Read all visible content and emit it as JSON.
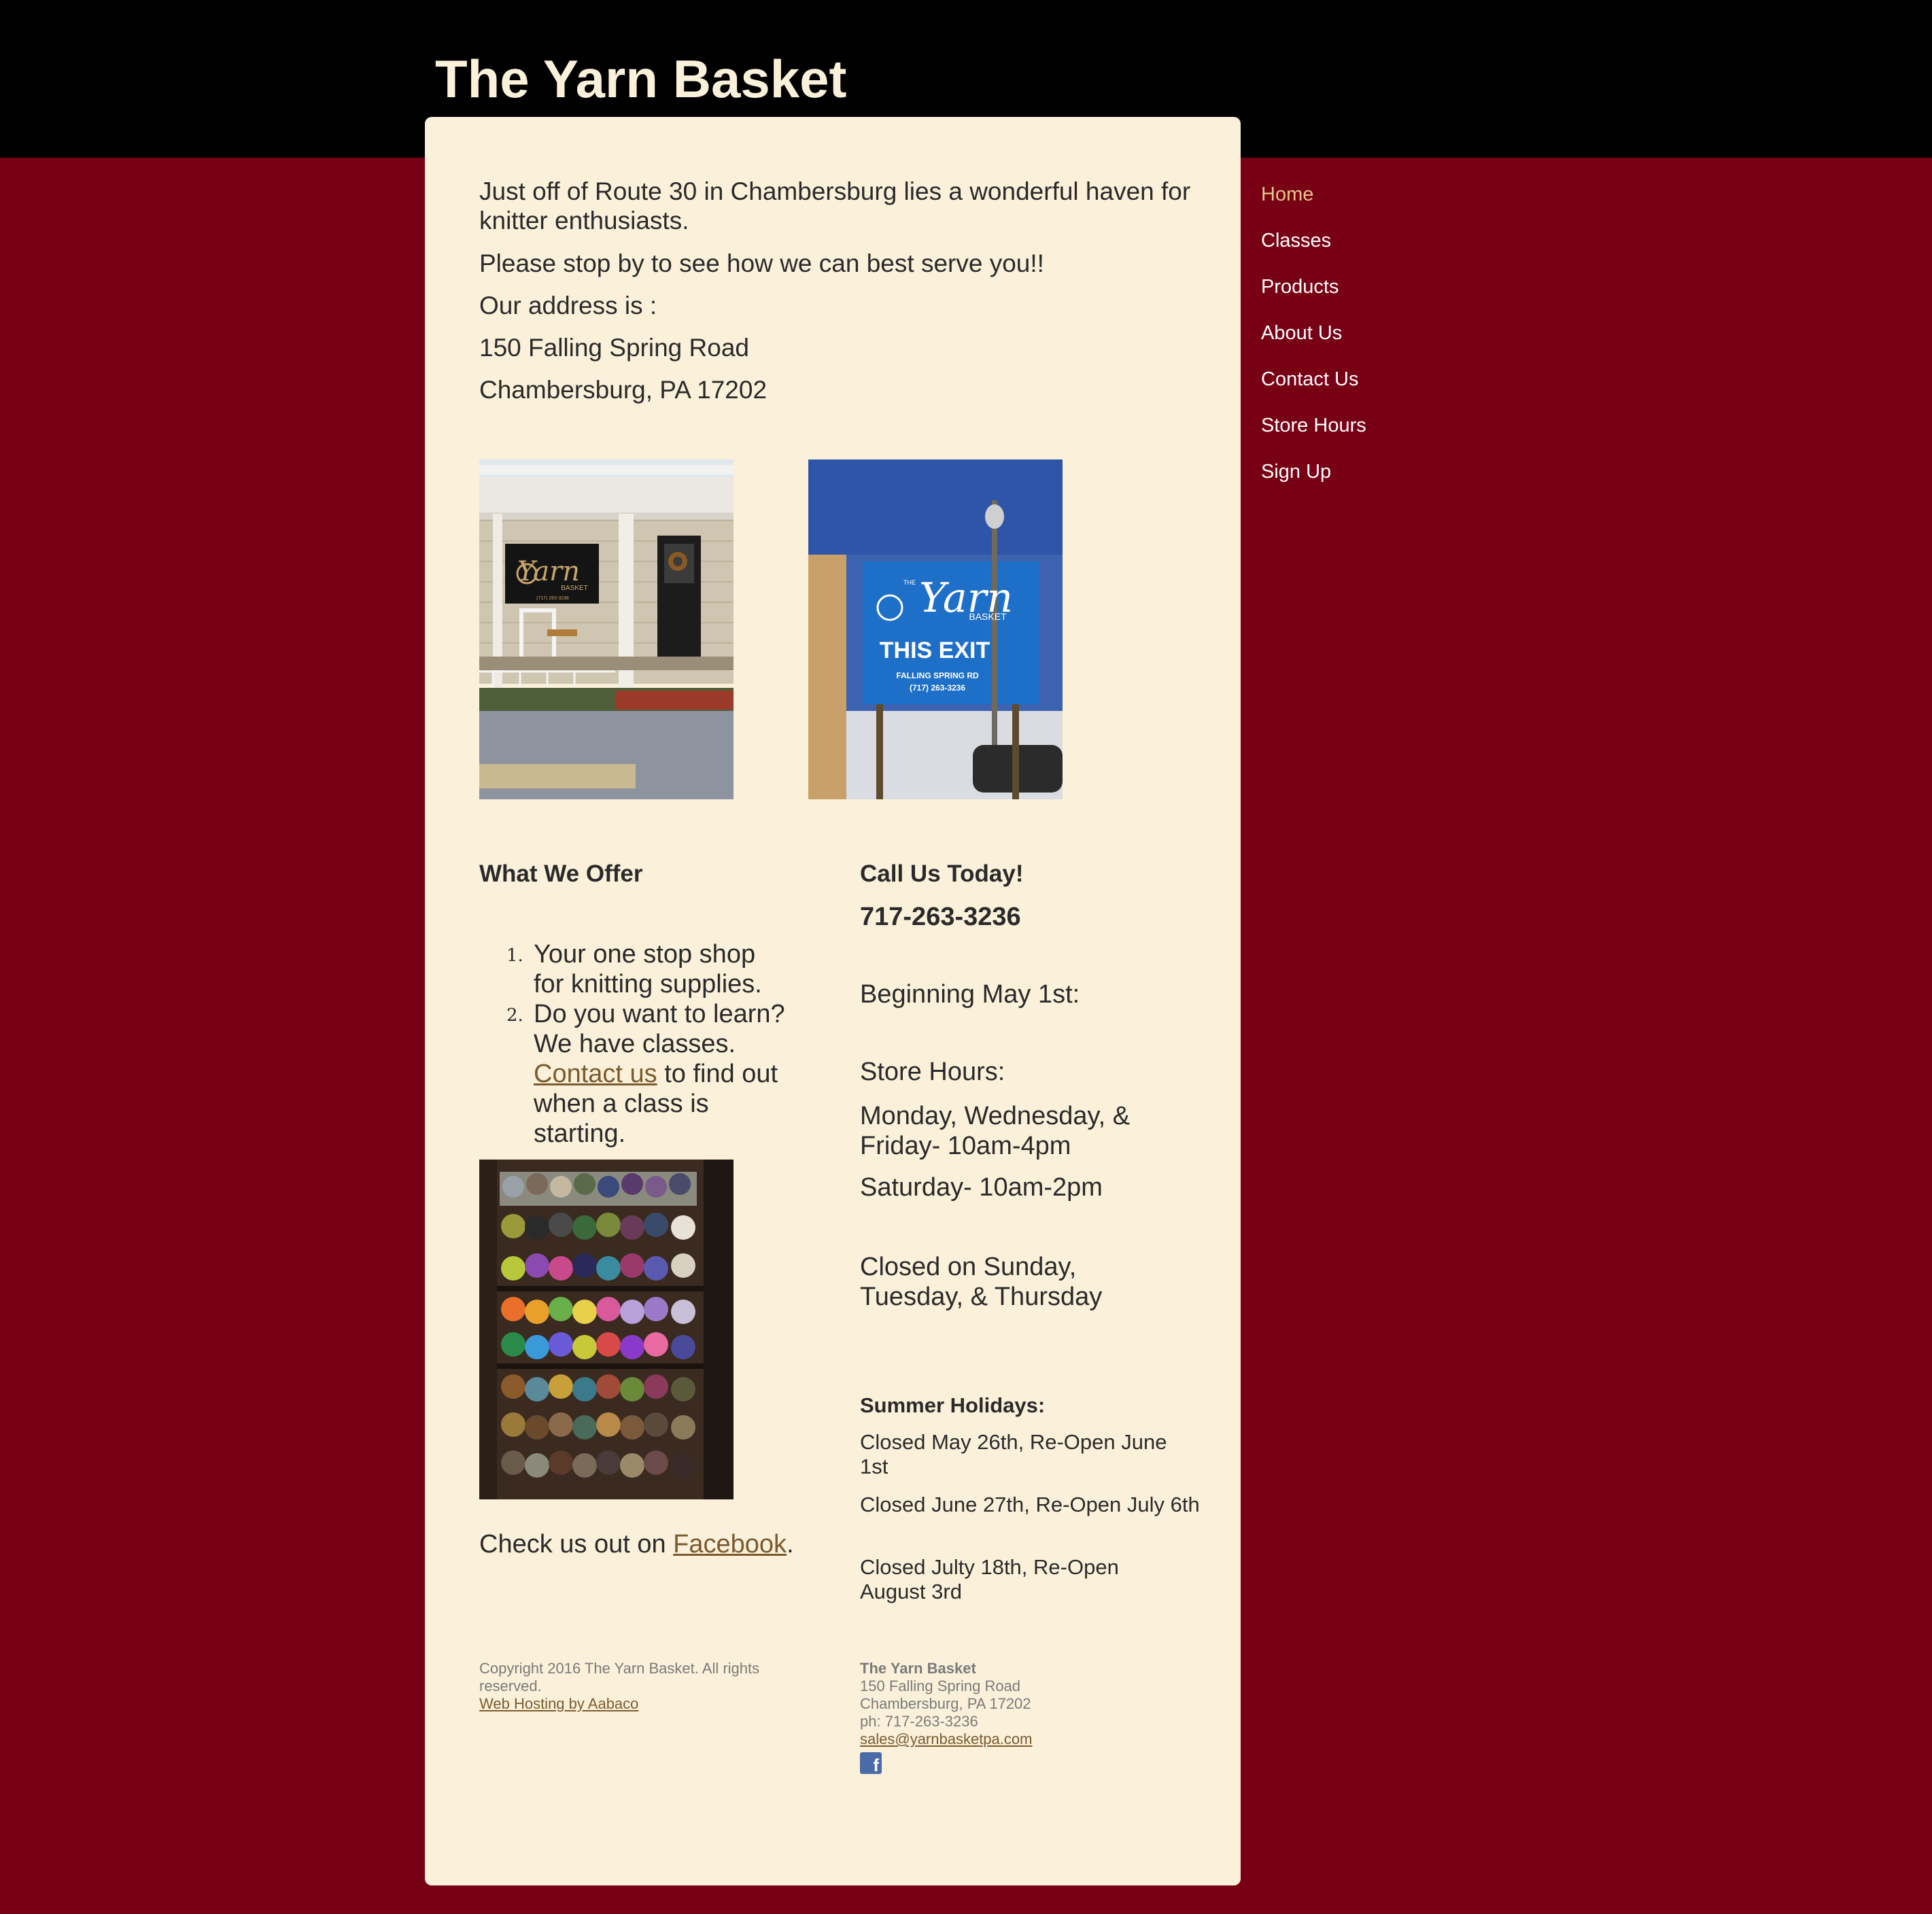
{
  "site": {
    "title": "The Yarn Basket"
  },
  "nav": {
    "items": [
      {
        "label": "Home",
        "active": true
      },
      {
        "label": "Classes"
      },
      {
        "label": "Products"
      },
      {
        "label": "About Us"
      },
      {
        "label": "Contact Us"
      },
      {
        "label": "Store Hours"
      },
      {
        "label": "Sign Up"
      }
    ]
  },
  "intro": {
    "line1": "Just off of Route 30 in Chambersburg lies a wonderful haven for knitter enthusiasts.",
    "line2": "Please stop by to see how we can best serve you!!",
    "line3": "Our address is :",
    "street": "150 Falling Spring Road",
    "city": "Chambersburg, PA 17202"
  },
  "photos": {
    "storefront": {
      "sign_name": "Yarn",
      "sign_sub": "BASKET",
      "sign_phone": "(717) 263-3236"
    },
    "exit_sign": {
      "brand": "Yarn",
      "brand_pre": "THE",
      "brand_sub": "BASKET",
      "headline": "THIS EXIT",
      "road": "FALLING SPRING RD",
      "phone": "(717) 263-3236"
    }
  },
  "offer": {
    "heading": "What We Offer",
    "items": [
      {
        "number": "1.",
        "text": "Your one stop shop for knitting supplies."
      },
      {
        "number": "2.",
        "text_before": "Do you want to learn? We have classes. ",
        "link": "Contact us",
        "text_after": " to find out when a class is starting."
      }
    ],
    "facebook_before": "Check us out on ",
    "facebook_link": "Facebook",
    "facebook_after": "."
  },
  "contact": {
    "heading": "Call Us Today!",
    "phone": "717-263-3236",
    "beginning": "Beginning May 1st:",
    "hours_heading": "Store Hours:",
    "hours_weekday": "Monday, Wednesday, & Friday- 10am-4pm",
    "hours_saturday": "Saturday- 10am-2pm",
    "closed": "Closed on Sunday, Tuesday, & Thursday",
    "holidays_heading": "Summer Holidays:",
    "holidays": [
      "Closed May 26th, Re-Open June 1st",
      "Closed June 27th, Re-Open July 6th",
      "Closed Julty 18th, Re-Open August 3rd"
    ]
  },
  "footer": {
    "copyright": "Copyright 2016 The Yarn Basket. All rights reserved.",
    "hosting_link": "Web Hosting by Aabaco",
    "biz_name": "The Yarn Basket",
    "street": "150 Falling Spring Road",
    "city": "Chambersburg, PA 17202",
    "phone": "ph: 717-263-3236",
    "email": "sales@yarnbasketpa.com",
    "facebook_icon_letter": "f"
  },
  "colors": {
    "page_background": "#780014",
    "header_background": "#000000",
    "panel_background": "#fbf1da",
    "link": "#7b5a2e",
    "nav_active": "#e7c58e",
    "nav_text": "#ffffff",
    "sign_blue": "#1e6fc8"
  },
  "icons": {
    "facebook": "facebook-icon"
  }
}
